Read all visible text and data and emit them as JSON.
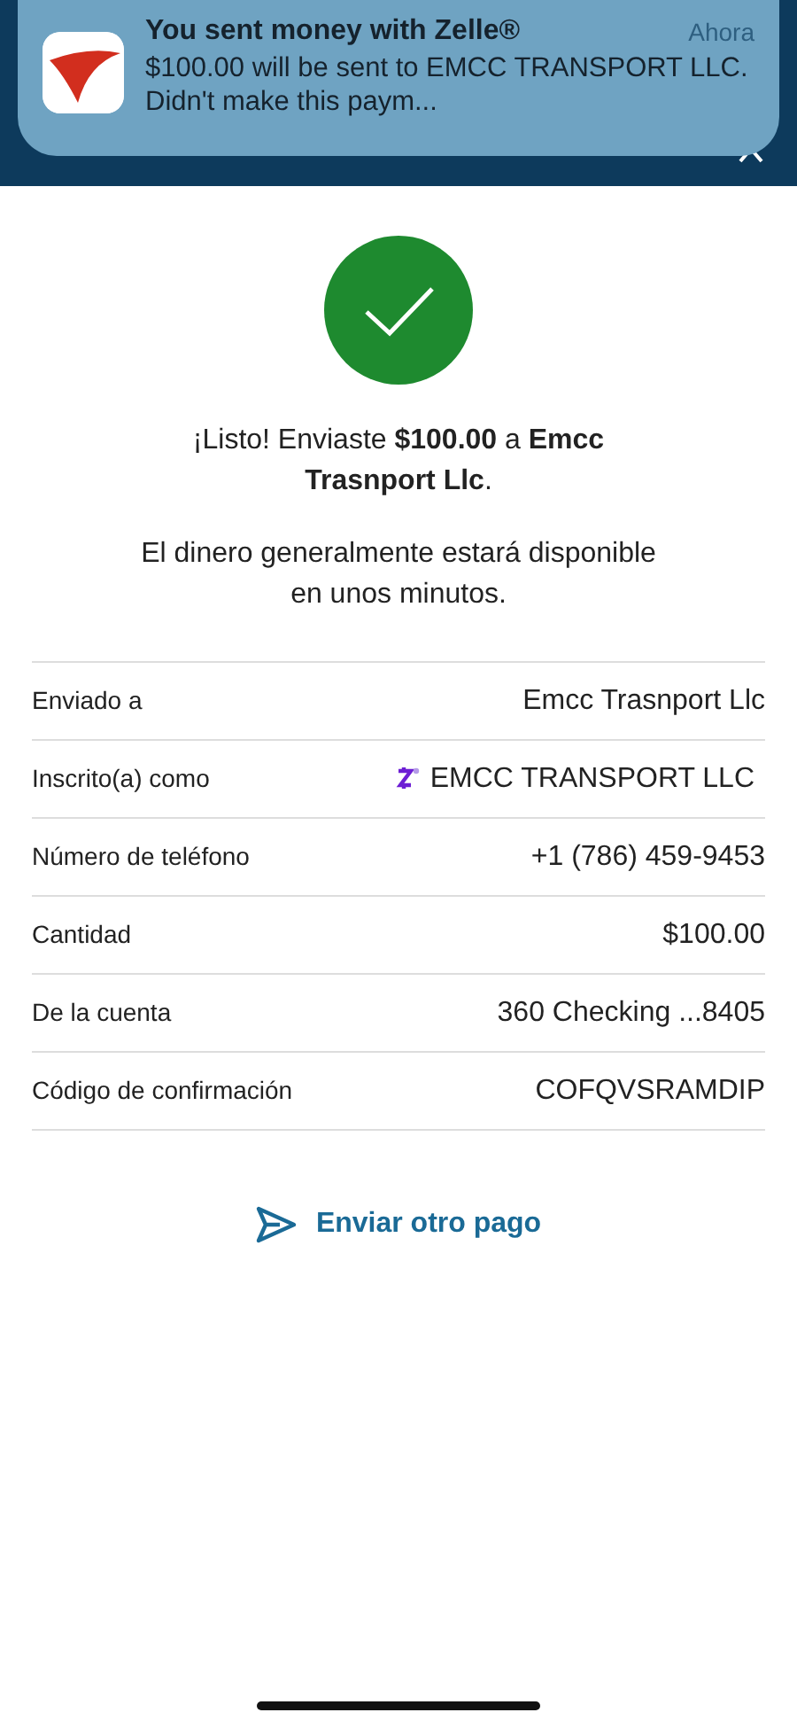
{
  "notification": {
    "title": "You sent money with Zelle®",
    "time": "Ahora",
    "body": "$100.00 will be sent to EMCC TRANSPORT LLC. Didn't make this paym..."
  },
  "confirmation": {
    "message": "¡Listo! Enviaste **$100.00** a **Emcc Trasnport Llc**.",
    "note": "El dinero generalmente estará disponible en unos minutos."
  },
  "details": [
    {
      "label": "Enviado a",
      "value": "Emcc Trasnport Llc",
      "kind": "plain"
    },
    {
      "label": "Inscrito(a) como",
      "value": "EMCC TRANSPORT LLC",
      "kind": "zelle"
    },
    {
      "label": "Número de teléfono",
      "value": "+1 (786) 459-9453",
      "kind": "plain"
    },
    {
      "label": "Cantidad",
      "value": "$100.00",
      "kind": "plain"
    },
    {
      "label": "De la cuenta",
      "value": "360 Checking ...8405",
      "kind": "plain"
    },
    {
      "label": "Código de confirmación",
      "value": "COFQVSRAMDIP",
      "kind": "plain"
    }
  ],
  "action": {
    "label": "Enviar otro pago"
  }
}
